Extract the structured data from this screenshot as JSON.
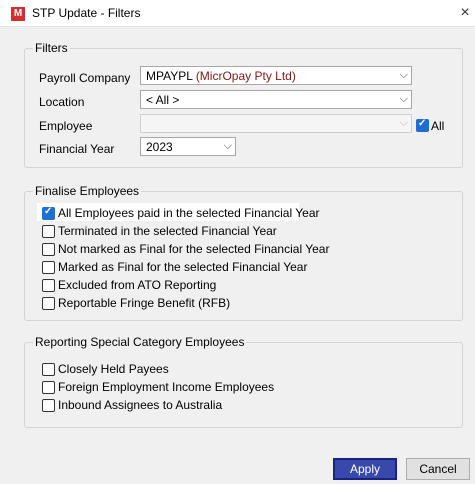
{
  "window": {
    "title": "STP Update - Filters",
    "app_icon": "M",
    "close_glyph": "×"
  },
  "filters": {
    "legend": "Filters",
    "payroll_company": {
      "label": "Payroll Company",
      "code": "MPAYPL",
      "name": "(MicrOpay Pty Ltd)"
    },
    "location": {
      "label": "Location",
      "value": "< All >"
    },
    "employee": {
      "label": "Employee",
      "value": "",
      "all_label": "All",
      "all_checked": true
    },
    "financial_year": {
      "label": "Financial Year",
      "value": "2023"
    }
  },
  "finalise": {
    "legend": "Finalise Employees",
    "options": [
      {
        "label": "All Employees paid in the selected Financial Year",
        "checked": true
      },
      {
        "label": "Terminated in the selected Financial Year",
        "checked": false
      },
      {
        "label": "Not marked as Final for the selected Financial Year",
        "checked": false
      },
      {
        "label": "Marked as Final for the selected Financial Year",
        "checked": false
      },
      {
        "label": "Excluded from ATO Reporting",
        "checked": false
      },
      {
        "label": "Reportable Fringe Benefit (RFB)",
        "checked": false
      }
    ]
  },
  "special": {
    "legend": "Reporting Special Category Employees",
    "options": [
      {
        "label": "Closely Held Payees",
        "checked": false
      },
      {
        "label": "Foreign Employment Income Employees",
        "checked": false
      },
      {
        "label": "Inbound Assignees to Australia",
        "checked": false
      }
    ]
  },
  "buttons": {
    "apply": "Apply",
    "cancel": "Cancel"
  },
  "colors": {
    "accent": "#1f6fd1",
    "apply_bg": "#3949ab",
    "company_text": "#7b1a1a"
  }
}
